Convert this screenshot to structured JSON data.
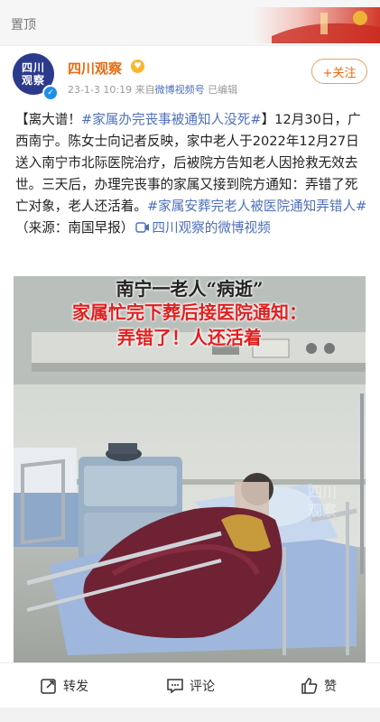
{
  "top_bar": {
    "pin_label": "置顶"
  },
  "author": {
    "avatar_lines": [
      "四川",
      "观察"
    ],
    "name": "四川观察",
    "follow_label": "+关注"
  },
  "meta": {
    "timestamp": "23-1-3 10:19",
    "source_prefix": "来自",
    "source": "微博视频号",
    "edited": "已编辑"
  },
  "post": {
    "segments": [
      {
        "type": "text",
        "value": "【离大谱！"
      },
      {
        "type": "tag",
        "value": "#家属办完丧事被通知人没死#"
      },
      {
        "type": "text",
        "value": "】12月30日，广西南宁。陈女士向记者反映，家中老人于2022年12月27日送入南宁市北际医院治疗，后被院方告知老人因抢救无效去世。三天后，办理完丧事的家属又接到院方通知：弄错了死亡对象，老人还活着。"
      },
      {
        "type": "tag",
        "value": "#家属安葬完老人被医院通知弄错人#"
      },
      {
        "type": "text",
        "value": "（来源：南国早报）"
      },
      {
        "type": "video",
        "value": "四川观察的微博视频"
      }
    ]
  },
  "media": {
    "caption_top": "南宁一老人“病逝”",
    "caption_line1": "家属忙完下葬后接医院通知：",
    "caption_line2": "弄错了！人还活着",
    "watermark_lines": [
      "四川",
      "观察"
    ]
  },
  "actions": {
    "repost": "转发",
    "comment": "评论",
    "like": "赞"
  },
  "colors": {
    "accent_orange": "#e86a10",
    "link_blue": "#4e6fbb",
    "caption_red": "#e02020"
  }
}
